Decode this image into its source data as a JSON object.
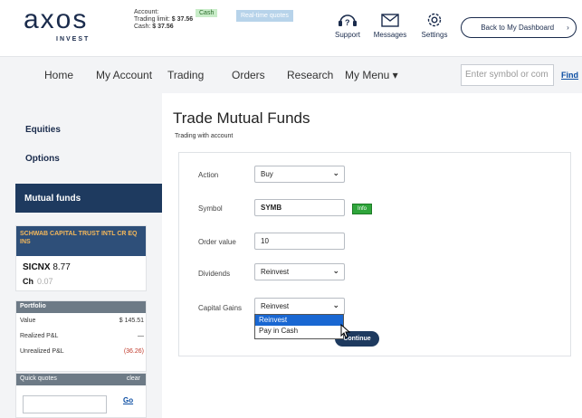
{
  "header": {
    "logo_text": "axos",
    "logo_sub": "INVEST",
    "account_label": "Account:",
    "trading_limit_label": "Trading limit:",
    "trading_limit_value": "$ 37.56",
    "cash_label": "Cash:",
    "cash_value": "$ 37.56",
    "cash_badge": "Cash",
    "realtime_quotes": "Real-time quotes",
    "support": "Support",
    "messages": "Messages",
    "settings": "Settings",
    "back_button": "Back to My Dashboard",
    "back_chevron": "›"
  },
  "nav": {
    "items": [
      "Home",
      "My Account",
      "Trading",
      "Orders",
      "Research",
      "My Menu ▾"
    ],
    "symbol_placeholder": "Enter symbol or com",
    "find": "Find"
  },
  "sidebar": {
    "equities": "Equities",
    "options": "Options",
    "mutual_funds": "Mutual funds",
    "quote": {
      "name": "SCHWAB CAPITAL TRUST INTL CR EQ INS",
      "symbol": "SICNX",
      "price": "8.77",
      "change_label": "Ch",
      "change_value": "0.07"
    },
    "portfolio": {
      "title": "Portfolio",
      "rows": [
        {
          "label": "Value",
          "value": "$ 145.51",
          "color": "#333333"
        },
        {
          "label": "Realized P&L",
          "value": "—",
          "color": "#333333"
        },
        {
          "label": "Unrealized P&L",
          "value": "(36.26)",
          "color": "#c0392b"
        }
      ]
    },
    "quick_quotes": {
      "title": "Quick quotes",
      "clear": "clear",
      "go": "Go"
    }
  },
  "main": {
    "title": "Trade Mutual Funds",
    "subtitle": "Trading with account",
    "form": {
      "action_label": "Action",
      "action_value": "Buy",
      "symbol_label": "Symbol",
      "symbol_value": "SYMB",
      "info_button": "Info",
      "order_value_label": "Order value",
      "order_value": "10",
      "dividends_label": "Dividends",
      "dividends_value": "Reinvest",
      "capital_gains_label": "Capital Gains",
      "capital_gains_value": "Reinvest",
      "dropdown_options": [
        "Reinvest",
        "Pay in Cash"
      ],
      "continue_button": "Continue"
    }
  },
  "colors": {
    "navy": "#1e3a5f",
    "link": "#0b4da2",
    "info_green": "#2fa53b",
    "select_blue": "#1967d2",
    "negative": "#c0392b"
  }
}
